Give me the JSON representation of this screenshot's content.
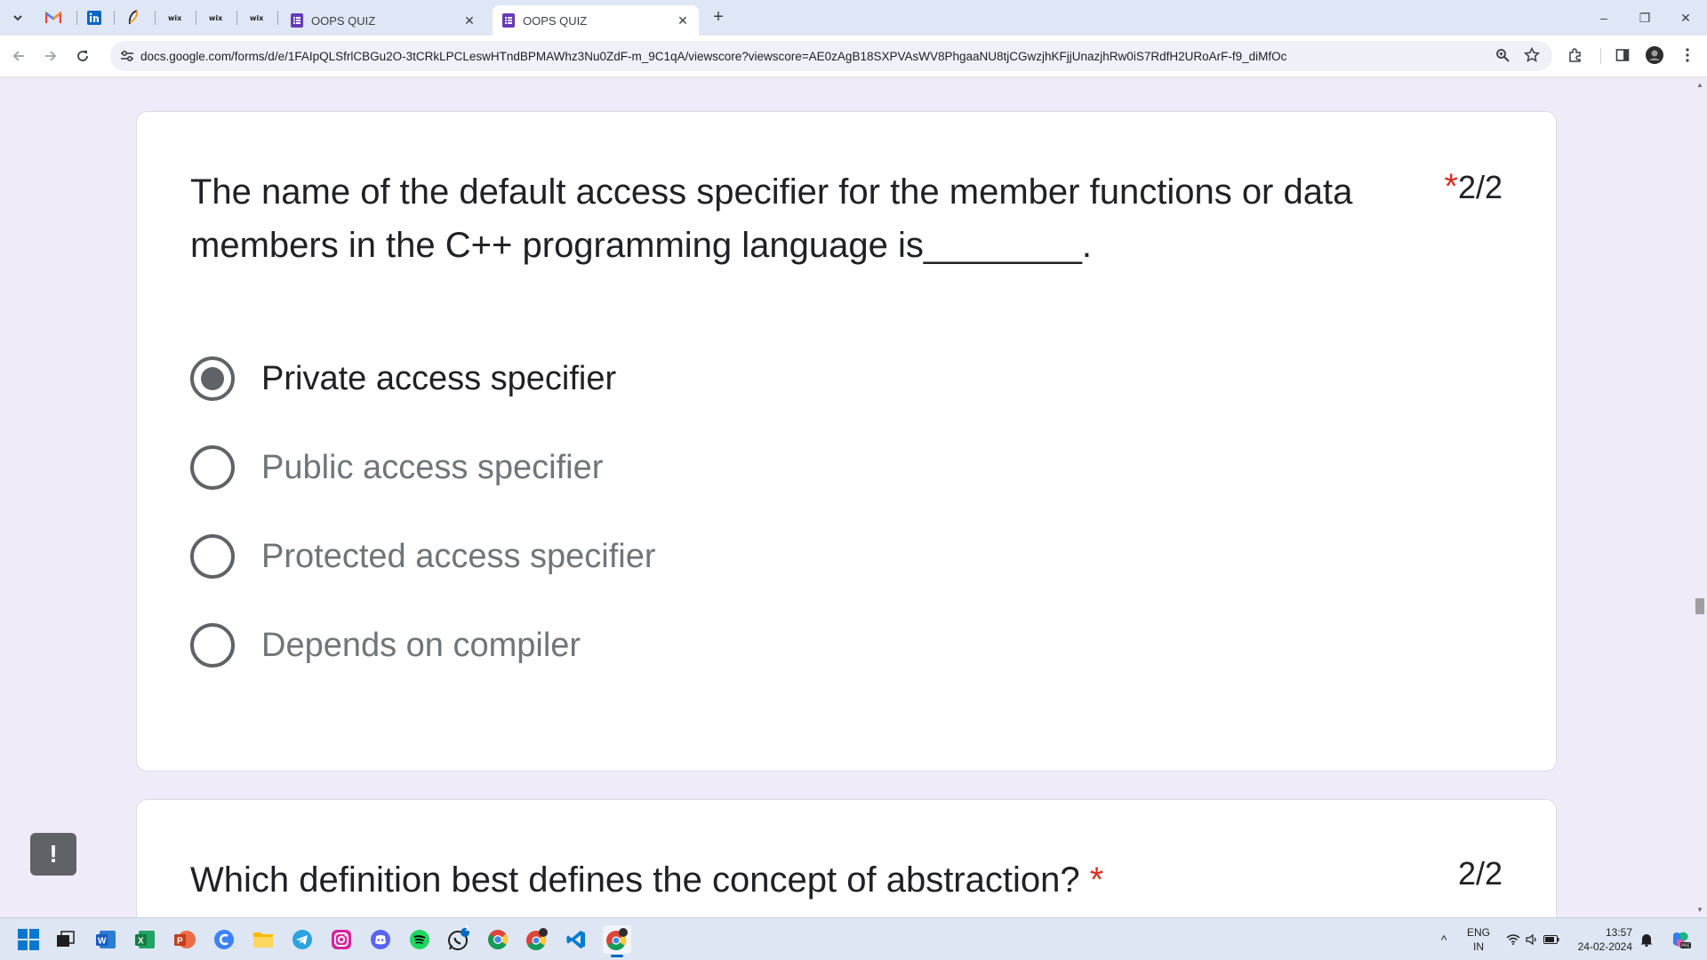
{
  "browser": {
    "tabs": [
      {
        "title": "OOPS QUIZ",
        "close": "✕",
        "active": false
      },
      {
        "title": "OOPS QUIZ",
        "close": "✕",
        "active": true
      }
    ],
    "new_tab": "+",
    "url": "docs.google.com/forms/d/e/1FAIpQLSfrlCBGu2O-3tCRkLPCLeswHTndBPMAWhz3Nu0ZdF-m_9C1qA/viewscore?viewscore=AE0zAgB18SXPVAsWV8PhgaaNU8tjCGwzjhKFjjUnazjhRw0iS7RdfH2URoArF-f9_diMfOc",
    "window_controls": {
      "minimize": "–",
      "restore": "❐",
      "close": "✕"
    }
  },
  "form": {
    "question1": {
      "title": "The name of the default access specifier for the member functions or data members in the C++ programming language is________.",
      "required_mark": "*",
      "points": "2/2",
      "options": [
        {
          "label": "Private access specifier",
          "selected": true
        },
        {
          "label": "Public access specifier",
          "selected": false
        },
        {
          "label": "Protected access specifier",
          "selected": false
        },
        {
          "label": "Depends on compiler",
          "selected": false
        }
      ]
    },
    "question2": {
      "title": "Which definition best defines the concept of abstraction?",
      "required_mark": "*",
      "points": "2/2"
    },
    "feedback_label": "!"
  },
  "taskbar": {
    "tray": {
      "language": "ENG",
      "region": "IN",
      "time": "13:57",
      "date": "24-02-2024",
      "chevron": "^"
    },
    "whatsapp_badge": "1"
  },
  "colors": {
    "page_bg": "#f0ebf8",
    "required": "#d93025",
    "forms_purple": "#673ab7",
    "taskbar_bg": "#dde6f2"
  }
}
